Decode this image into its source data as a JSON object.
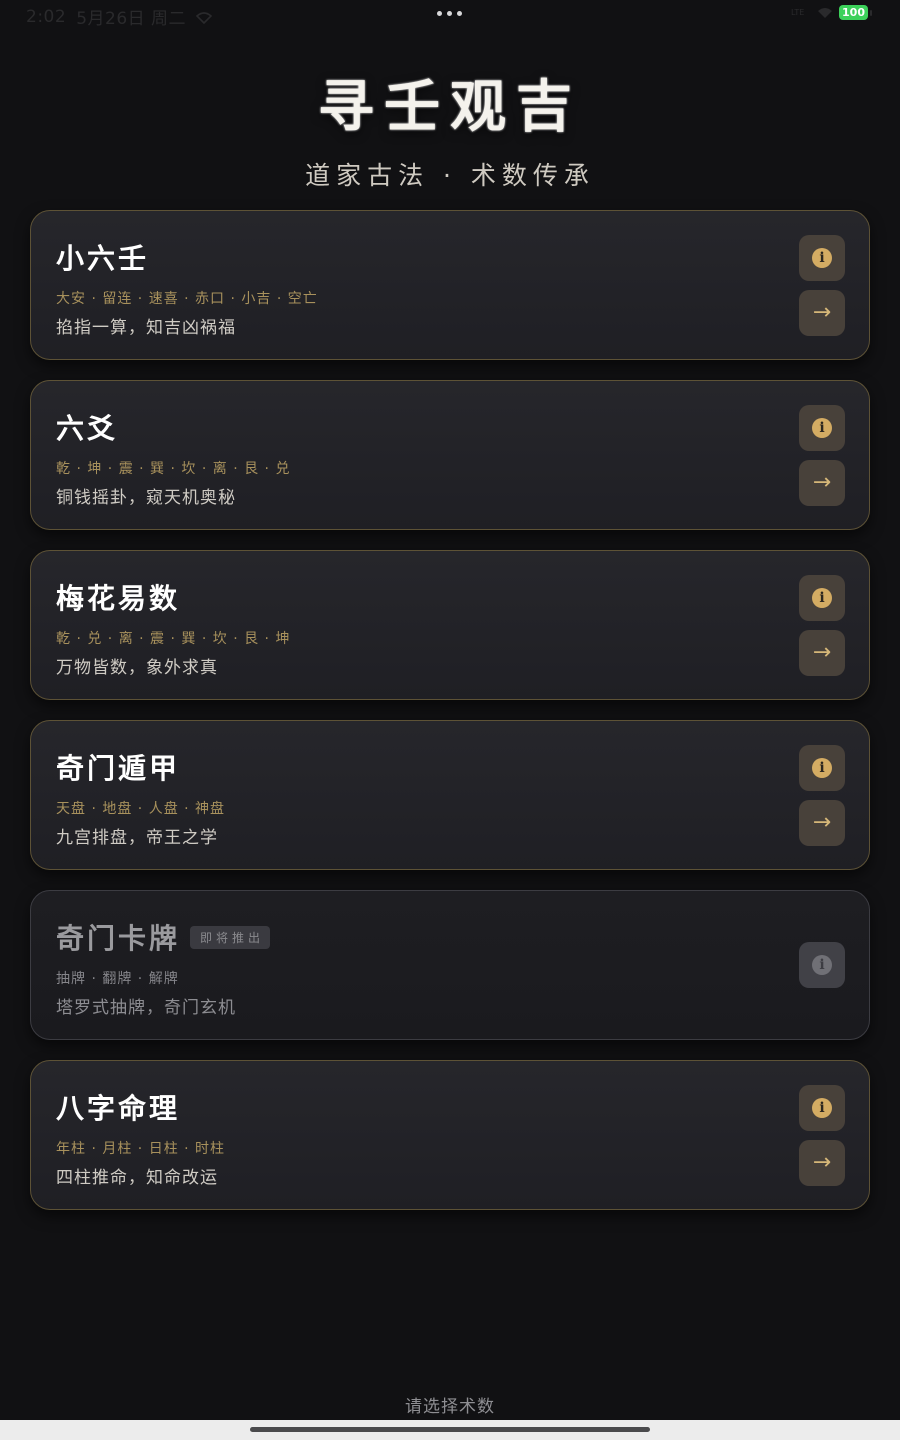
{
  "status_bar": {
    "time": "2:02",
    "date": "5月26日 周二",
    "signal_label": "LTE",
    "battery": "100"
  },
  "header": {
    "title": "寻壬观吉",
    "subtitle": "道家古法 · 术数传承"
  },
  "cards": [
    {
      "name": "小六壬",
      "tags": "大安 · 留连 · 速喜 · 赤口 · 小吉 · 空亡",
      "desc": "掐指一算，知吉凶祸福",
      "enabled": true
    },
    {
      "name": "六爻",
      "tags": "乾 · 坤 · 震 · 巽 · 坎 · 离 · 艮 · 兑",
      "desc": "铜钱摇卦，窥天机奥秘",
      "enabled": true
    },
    {
      "name": "梅花易数",
      "tags": "乾 · 兑 · 离 · 震 · 巽 · 坎 · 艮 · 坤",
      "desc": "万物皆数，象外求真",
      "enabled": true
    },
    {
      "name": "奇门遁甲",
      "tags": "天盘 · 地盘 · 人盘 · 神盘",
      "desc": "九宫排盘，帝王之学",
      "enabled": true
    },
    {
      "name": "奇门卡牌",
      "badge": "即将推出",
      "tags": "抽牌 · 翻牌 · 解牌",
      "desc": "塔罗式抽牌，奇门玄机",
      "enabled": false
    },
    {
      "name": "八字命理",
      "tags": "年柱 · 月柱 · 日柱 · 时柱",
      "desc": "四柱推命，知命改运",
      "enabled": true
    }
  ],
  "buttons": {
    "info_glyph": "i",
    "go_glyph": "→"
  },
  "footer": {
    "hint": "请选择术数"
  },
  "colors": {
    "background": "#111113",
    "card_border": "#5d5236",
    "accent_gold": "#d4ac63",
    "tag_gold": "#a8915c",
    "battery_green": "#3cd15a"
  },
  "icons": [
    "wifi-icon",
    "info-icon",
    "arrow-right-icon",
    "more-dots-icon"
  ]
}
